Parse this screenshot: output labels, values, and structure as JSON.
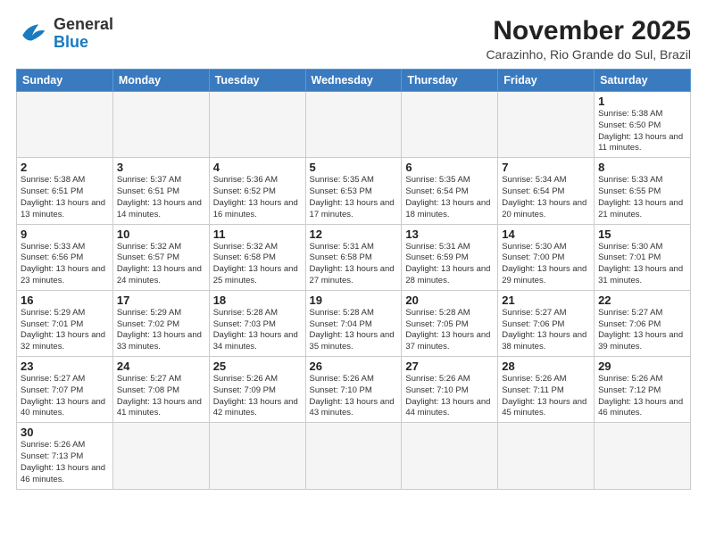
{
  "logo": {
    "line1": "General",
    "line2": "Blue"
  },
  "title": "November 2025",
  "location": "Carazinho, Rio Grande do Sul, Brazil",
  "weekdays": [
    "Sunday",
    "Monday",
    "Tuesday",
    "Wednesday",
    "Thursday",
    "Friday",
    "Saturday"
  ],
  "weeks": [
    [
      {
        "day": "",
        "info": ""
      },
      {
        "day": "",
        "info": ""
      },
      {
        "day": "",
        "info": ""
      },
      {
        "day": "",
        "info": ""
      },
      {
        "day": "",
        "info": ""
      },
      {
        "day": "",
        "info": ""
      },
      {
        "day": "1",
        "info": "Sunrise: 5:38 AM\nSunset: 6:50 PM\nDaylight: 13 hours and 11 minutes."
      }
    ],
    [
      {
        "day": "2",
        "info": "Sunrise: 5:38 AM\nSunset: 6:51 PM\nDaylight: 13 hours and 13 minutes."
      },
      {
        "day": "3",
        "info": "Sunrise: 5:37 AM\nSunset: 6:51 PM\nDaylight: 13 hours and 14 minutes."
      },
      {
        "day": "4",
        "info": "Sunrise: 5:36 AM\nSunset: 6:52 PM\nDaylight: 13 hours and 16 minutes."
      },
      {
        "day": "5",
        "info": "Sunrise: 5:35 AM\nSunset: 6:53 PM\nDaylight: 13 hours and 17 minutes."
      },
      {
        "day": "6",
        "info": "Sunrise: 5:35 AM\nSunset: 6:54 PM\nDaylight: 13 hours and 18 minutes."
      },
      {
        "day": "7",
        "info": "Sunrise: 5:34 AM\nSunset: 6:54 PM\nDaylight: 13 hours and 20 minutes."
      },
      {
        "day": "8",
        "info": "Sunrise: 5:33 AM\nSunset: 6:55 PM\nDaylight: 13 hours and 21 minutes."
      }
    ],
    [
      {
        "day": "9",
        "info": "Sunrise: 5:33 AM\nSunset: 6:56 PM\nDaylight: 13 hours and 23 minutes."
      },
      {
        "day": "10",
        "info": "Sunrise: 5:32 AM\nSunset: 6:57 PM\nDaylight: 13 hours and 24 minutes."
      },
      {
        "day": "11",
        "info": "Sunrise: 5:32 AM\nSunset: 6:58 PM\nDaylight: 13 hours and 25 minutes."
      },
      {
        "day": "12",
        "info": "Sunrise: 5:31 AM\nSunset: 6:58 PM\nDaylight: 13 hours and 27 minutes."
      },
      {
        "day": "13",
        "info": "Sunrise: 5:31 AM\nSunset: 6:59 PM\nDaylight: 13 hours and 28 minutes."
      },
      {
        "day": "14",
        "info": "Sunrise: 5:30 AM\nSunset: 7:00 PM\nDaylight: 13 hours and 29 minutes."
      },
      {
        "day": "15",
        "info": "Sunrise: 5:30 AM\nSunset: 7:01 PM\nDaylight: 13 hours and 31 minutes."
      }
    ],
    [
      {
        "day": "16",
        "info": "Sunrise: 5:29 AM\nSunset: 7:01 PM\nDaylight: 13 hours and 32 minutes."
      },
      {
        "day": "17",
        "info": "Sunrise: 5:29 AM\nSunset: 7:02 PM\nDaylight: 13 hours and 33 minutes."
      },
      {
        "day": "18",
        "info": "Sunrise: 5:28 AM\nSunset: 7:03 PM\nDaylight: 13 hours and 34 minutes."
      },
      {
        "day": "19",
        "info": "Sunrise: 5:28 AM\nSunset: 7:04 PM\nDaylight: 13 hours and 35 minutes."
      },
      {
        "day": "20",
        "info": "Sunrise: 5:28 AM\nSunset: 7:05 PM\nDaylight: 13 hours and 37 minutes."
      },
      {
        "day": "21",
        "info": "Sunrise: 5:27 AM\nSunset: 7:06 PM\nDaylight: 13 hours and 38 minutes."
      },
      {
        "day": "22",
        "info": "Sunrise: 5:27 AM\nSunset: 7:06 PM\nDaylight: 13 hours and 39 minutes."
      }
    ],
    [
      {
        "day": "23",
        "info": "Sunrise: 5:27 AM\nSunset: 7:07 PM\nDaylight: 13 hours and 40 minutes."
      },
      {
        "day": "24",
        "info": "Sunrise: 5:27 AM\nSunset: 7:08 PM\nDaylight: 13 hours and 41 minutes."
      },
      {
        "day": "25",
        "info": "Sunrise: 5:26 AM\nSunset: 7:09 PM\nDaylight: 13 hours and 42 minutes."
      },
      {
        "day": "26",
        "info": "Sunrise: 5:26 AM\nSunset: 7:10 PM\nDaylight: 13 hours and 43 minutes."
      },
      {
        "day": "27",
        "info": "Sunrise: 5:26 AM\nSunset: 7:10 PM\nDaylight: 13 hours and 44 minutes."
      },
      {
        "day": "28",
        "info": "Sunrise: 5:26 AM\nSunset: 7:11 PM\nDaylight: 13 hours and 45 minutes."
      },
      {
        "day": "29",
        "info": "Sunrise: 5:26 AM\nSunset: 7:12 PM\nDaylight: 13 hours and 46 minutes."
      }
    ],
    [
      {
        "day": "30",
        "info": "Sunrise: 5:26 AM\nSunset: 7:13 PM\nDaylight: 13 hours and 46 minutes."
      },
      {
        "day": "",
        "info": ""
      },
      {
        "day": "",
        "info": ""
      },
      {
        "day": "",
        "info": ""
      },
      {
        "day": "",
        "info": ""
      },
      {
        "day": "",
        "info": ""
      },
      {
        "day": "",
        "info": ""
      }
    ]
  ]
}
